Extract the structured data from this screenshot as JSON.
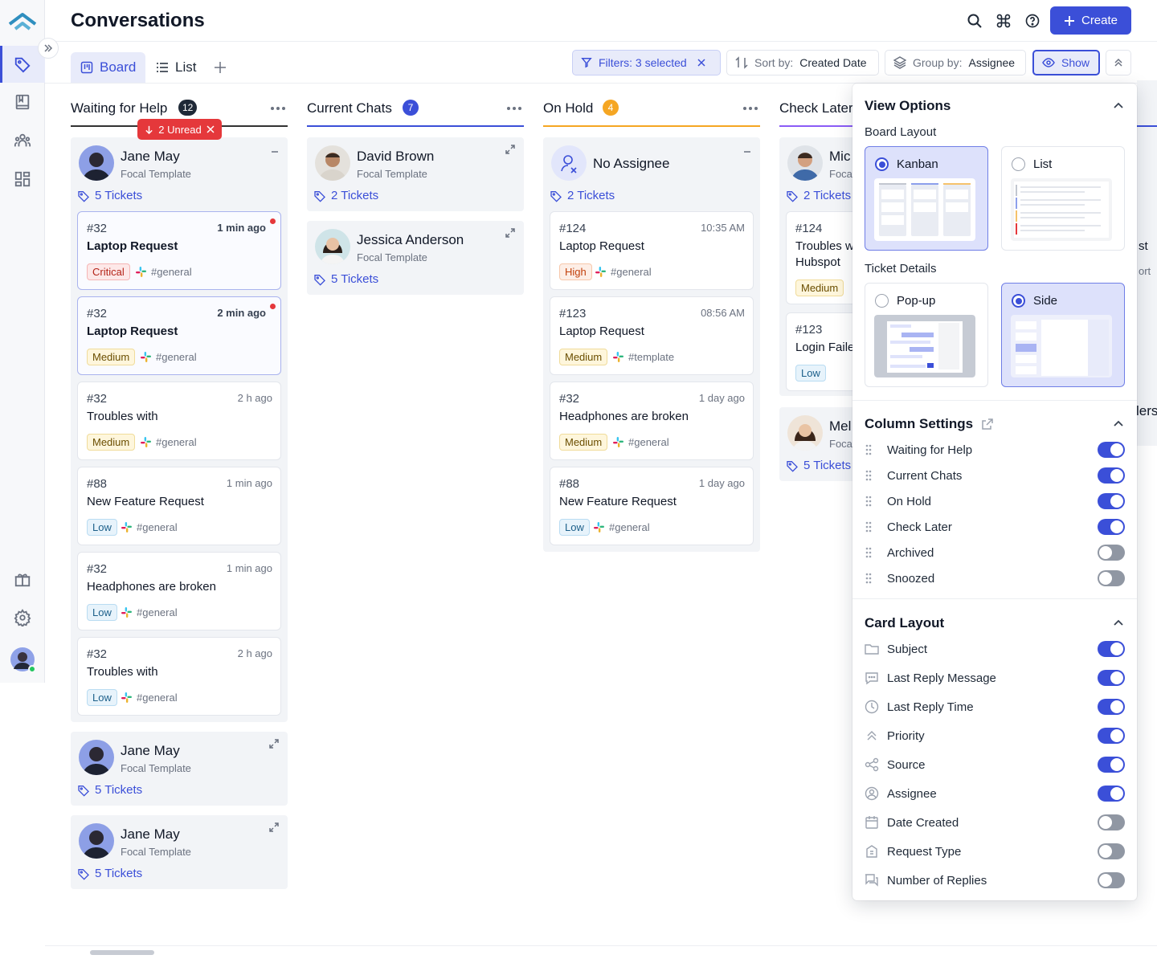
{
  "header": {
    "title": "Conversations",
    "create_label": "Create"
  },
  "tabs": [
    {
      "label": "Board",
      "active": true
    },
    {
      "label": "List",
      "active": false
    }
  ],
  "toolbar": {
    "filters_prefix": "Filters:",
    "filters_value": "3 selected",
    "sort_prefix": "Sort by:",
    "sort_value": "Created Date",
    "group_prefix": "Group by:",
    "group_value": "Assignee",
    "show_label": "Show"
  },
  "columns": [
    {
      "title": "Waiting for Help",
      "count": "12",
      "count_color": "#1f2937",
      "accent": "#333333",
      "unread_label": "2 Unread",
      "groups": [
        {
          "name": "Jane May",
          "sub": "Focal Template",
          "tickets": "5 Tickets",
          "avatar": "jane",
          "expanded": true,
          "cards": [
            {
              "num": "#32",
              "time": "1 min ago",
              "title": "Laptop Request",
              "priority": "Critical",
              "source": "#general",
              "unread": true
            },
            {
              "num": "#32",
              "time": "2 min ago",
              "title": "Laptop Request",
              "priority": "Medium",
              "source": "#general",
              "unread": true
            },
            {
              "num": "#32",
              "time": "2 h ago",
              "title": "Troubles with",
              "priority": "Medium",
              "source": "#general",
              "unread": false
            },
            {
              "num": "#88",
              "time": "1 min ago",
              "title": "New Feature Request",
              "priority": "Low",
              "source": "#general",
              "unread": false
            },
            {
              "num": "#32",
              "time": "1 min ago",
              "title": "Headphones are broken",
              "priority": "Low",
              "source": "#general",
              "unread": false
            },
            {
              "num": "#32",
              "time": "2 h ago",
              "title": "Troubles with",
              "priority": "Low",
              "source": "#general",
              "unread": false
            }
          ]
        },
        {
          "name": "Jane May",
          "sub": "Focal Template",
          "tickets": "5 Tickets",
          "avatar": "jane",
          "expanded": false,
          "cards": []
        },
        {
          "name": "Jane May",
          "sub": "Focal Template",
          "tickets": "5 Tickets",
          "avatar": "jane",
          "expanded": false,
          "cards": []
        }
      ]
    },
    {
      "title": "Current Chats",
      "count": "7",
      "count_color": "#3b4fd8",
      "accent": "#3b4fd8",
      "groups": [
        {
          "name": "David Brown",
          "sub": "Focal Template",
          "tickets": "2 Tickets",
          "avatar": "david",
          "expanded": false,
          "cards": []
        },
        {
          "name": "Jessica Anderson",
          "sub": "Focal Template",
          "tickets": "5 Tickets",
          "avatar": "jessica",
          "expanded": false,
          "cards": []
        }
      ]
    },
    {
      "title": "On Hold",
      "count": "4",
      "count_color": "#f5a623",
      "accent": "#f5a623",
      "groups": [
        {
          "name": "No Assignee",
          "sub": "",
          "tickets": "2 Tickets",
          "avatar": "none",
          "expanded": true,
          "cards": [
            {
              "num": "#124",
              "time": "10:35 AM",
              "title": "Laptop Request",
              "priority": "High",
              "source": "#general",
              "unread": false
            },
            {
              "num": "#123",
              "time": "08:56 AM",
              "title": "Laptop Request",
              "priority": "Medium",
              "source": "#template",
              "unread": false
            },
            {
              "num": "#32",
              "time": "1 day ago",
              "title": "Headphones are broken",
              "priority": "Medium",
              "source": "#general",
              "unread": false
            },
            {
              "num": "#88",
              "time": "1 day ago",
              "title": "New Feature Request",
              "priority": "Low",
              "source": "#general",
              "unread": false
            }
          ]
        }
      ]
    },
    {
      "title": "Check Later",
      "count": "",
      "count_color": "#8b5cf6",
      "accent": "#8b5cf6",
      "groups": [
        {
          "name": "Mic",
          "sub": "Foca",
          "tickets": "2 Tickets",
          "avatar": "michael",
          "expanded": true,
          "cards": [
            {
              "num": "#124",
              "time": "",
              "title": "Troubles w",
              "title2": "Hubspot",
              "priority": "Medium",
              "source": "",
              "unread": false
            },
            {
              "num": "#123",
              "time": "",
              "title": "Login Faile",
              "priority": "Low",
              "source": "",
              "unread": false
            }
          ]
        },
        {
          "name": "Mel",
          "sub": "Foca",
          "tickets": "5 Tickets",
          "avatar": "melissa",
          "expanded": false,
          "cards": []
        }
      ]
    }
  ],
  "hidden_fragments": {
    "st": "st",
    "ort": "ort",
    "lers": "lers"
  },
  "view_options": {
    "title": "View Options",
    "board_layout_label": "Board Layout",
    "board_layouts": [
      {
        "label": "Kanban",
        "selected": true
      },
      {
        "label": "List",
        "selected": false
      }
    ],
    "ticket_details_label": "Ticket Details",
    "ticket_details": [
      {
        "label": "Pop-up",
        "selected": false
      },
      {
        "label": "Side",
        "selected": true
      }
    ],
    "column_settings_title": "Column Settings",
    "column_settings": [
      {
        "label": "Waiting for Help",
        "on": true
      },
      {
        "label": "Current Chats",
        "on": true
      },
      {
        "label": "On Hold",
        "on": true
      },
      {
        "label": "Check Later",
        "on": true
      },
      {
        "label": "Archived",
        "on": false
      },
      {
        "label": "Snoozed",
        "on": false
      }
    ],
    "card_layout_title": "Card Layout",
    "card_layout": [
      {
        "label": "Subject",
        "icon": "folder-icon",
        "on": true
      },
      {
        "label": "Last Reply Message",
        "icon": "message-icon",
        "on": true
      },
      {
        "label": "Last Reply Time",
        "icon": "clock-icon",
        "on": true
      },
      {
        "label": "Priority",
        "icon": "priority-icon",
        "on": true
      },
      {
        "label": "Source",
        "icon": "share-icon",
        "on": true
      },
      {
        "label": "Assignee",
        "icon": "user-circle-icon",
        "on": true
      },
      {
        "label": "Date Created",
        "icon": "calendar-icon",
        "on": false
      },
      {
        "label": "Request Type",
        "icon": "building-icon",
        "on": false
      },
      {
        "label": "Number of Replies",
        "icon": "chat-bubbles-icon",
        "on": false
      }
    ]
  },
  "colors": {
    "accent": "#3b4fd8",
    "danger": "#e5383b",
    "amber": "#f5a623",
    "violet": "#8b5cf6"
  }
}
